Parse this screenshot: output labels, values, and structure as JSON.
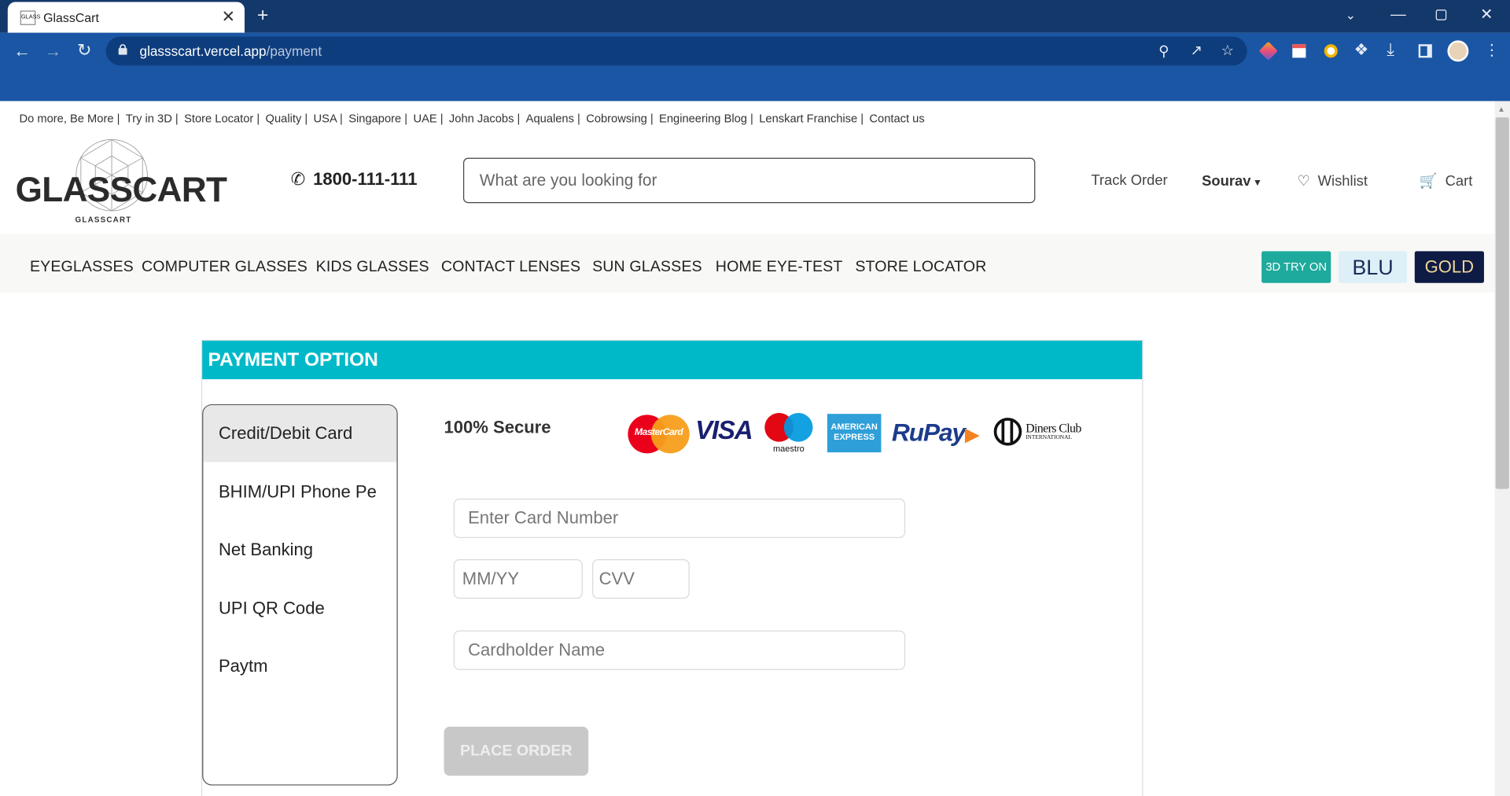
{
  "browser": {
    "tab_title": "GlassCart",
    "tab_favicon_text": "GLASS",
    "url_host": "glassscart.vercel.app",
    "url_path": "/payment"
  },
  "topnav": [
    "Do more, Be More |",
    "Try in 3D |",
    "Store Locator |",
    "Quality |",
    "USA |",
    "Singapore |",
    "UAE |",
    "John Jacobs |",
    "Aqualens |",
    "Cobrowsing |",
    "Engineering Blog |",
    "Lenskart Franchise |",
    "Contact us"
  ],
  "header": {
    "logo_text": "GLASSCART",
    "logo_subtext": "GLASSCART",
    "phone": "1800-111-111",
    "search_placeholder": "What are you looking for",
    "track_order": "Track Order",
    "user": "Sourav",
    "wishlist": "Wishlist",
    "cart": "Cart"
  },
  "categories": [
    "EYEGLASSES",
    "COMPUTER GLASSES",
    "KIDS GLASSES",
    "CONTACT LENSES",
    "SUN GLASSES",
    "HOME EYE-TEST",
    "STORE LOCATOR"
  ],
  "badges": {
    "tryon": "3D TRY ON",
    "blu": "BLU",
    "gold": "GOLD"
  },
  "payment": {
    "title": "PAYMENT OPTION",
    "options": [
      "Credit/Debit Card",
      "BHIM/UPI Phone Pe",
      "Net Banking",
      "UPI QR Code",
      "Paytm"
    ],
    "selected": "Credit/Debit Card",
    "secure_label": "100% Secure",
    "card_brands": {
      "mastercard": "MasterCard",
      "visa": "VISA",
      "maestro": "maestro",
      "amex_line1": "AMERICAN",
      "amex_line2": "EXPRESS",
      "rupay": "RuPay",
      "diners_line1": "Diners Club",
      "diners_line2": "INTERNATIONAL"
    },
    "card_number_placeholder": "Enter Card Number",
    "expiry_placeholder": "MM/YY",
    "cvv_placeholder": "CVV",
    "name_placeholder": "Cardholder Name",
    "place_order": "PLACE ORDER"
  },
  "colors": {
    "tabbar": "#13386a",
    "toolbar": "#1a56a4",
    "panel_header": "#00b9c8",
    "tryon": "#1eaa9c",
    "gold_bg": "#0e1b44"
  }
}
